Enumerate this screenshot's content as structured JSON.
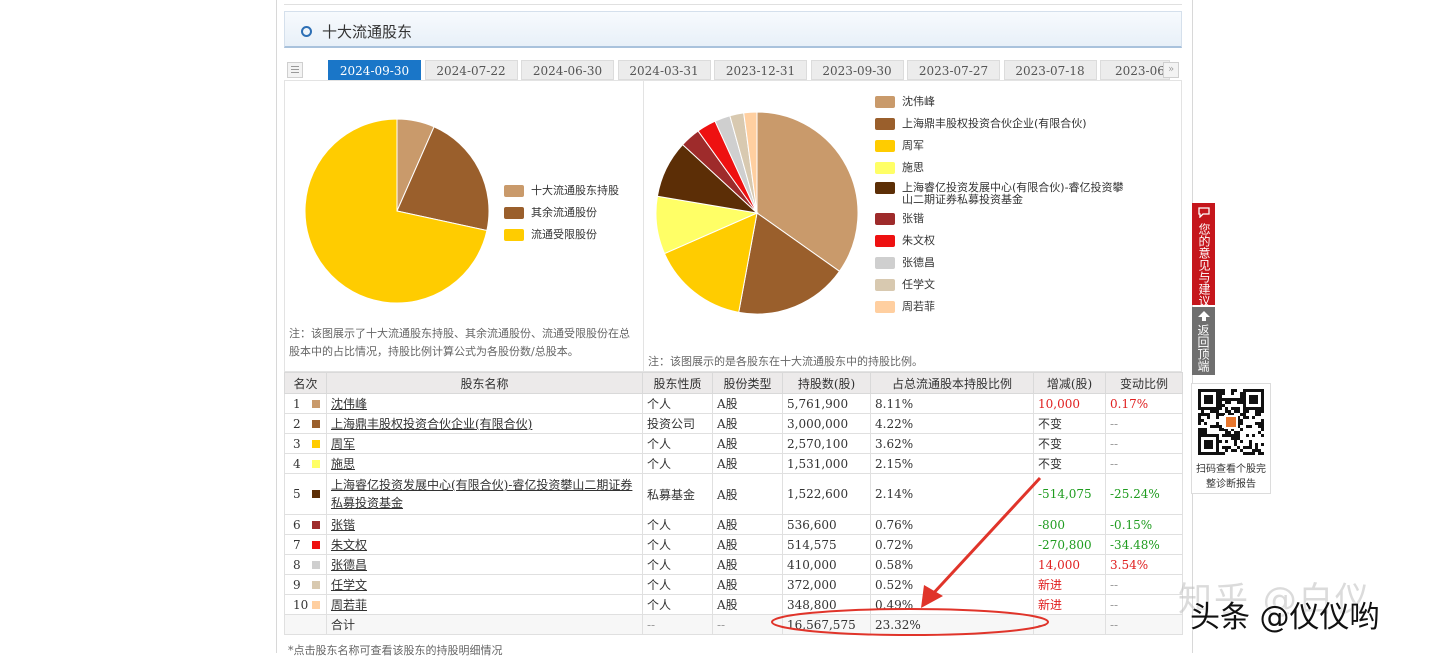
{
  "panel": {
    "title": "十大流通股东"
  },
  "tabs": [
    "2024-09-30",
    "2024-07-22",
    "2024-06-30",
    "2024-03-31",
    "2023-12-31",
    "2023-09-30",
    "2023-07-27",
    "2023-07-18",
    "2023-06"
  ],
  "active_tab": 0,
  "chart_data": [
    {
      "type": "pie",
      "legend": [
        "十大流通股东持股",
        "其余流通股份",
        "流通受限股份"
      ],
      "values": [
        6.6,
        21.8,
        71.6
      ],
      "colors": [
        "#c99a6b",
        "#9a5f2c",
        "#ffcc00"
      ]
    },
    {
      "type": "pie",
      "legend": [
        "沈伟峰",
        "上海鼎丰股权投资合伙企业(有限合伙)",
        "周军",
        "施思",
        "上海睿亿投资发展中心(有限合伙)-睿亿投资攀山二期证券私募投资基金",
        "张锴",
        "朱文权",
        "张德昌",
        "任学文",
        "周若菲"
      ],
      "values": [
        8.11,
        4.22,
        3.62,
        2.15,
        2.14,
        0.76,
        0.72,
        0.58,
        0.52,
        0.49
      ],
      "colors": [
        "#c99a6b",
        "#9a5f2c",
        "#ffcc00",
        "#ffff66",
        "#5c2e06",
        "#9e2b2b",
        "#ee1111",
        "#cfcfcf",
        "#d8c9b0",
        "#ffcfa0"
      ]
    }
  ],
  "notes": {
    "left": "注：该图展示了十大流通股东持股、其余流通股份、流通受限股份在总股本中的占比情况，持股比例计算公式为各股份数/总股本。",
    "right": "注：该图展示的是各股东在十大流通股东中的持股比例。"
  },
  "table": {
    "headers": [
      "名次",
      "股东名称",
      "股东性质",
      "股份类型",
      "持股数(股)",
      "占总流通股本持股比例",
      "增减(股)",
      "变动比例"
    ],
    "rows": [
      {
        "rank": "1",
        "color": "#c99a6b",
        "name": "沈伟峰",
        "nature": "个人",
        "type": "A股",
        "shares": "5,761,900",
        "ratio": "8.11%",
        "change": "10,000",
        "change_class": "red",
        "pct": "0.17%",
        "pct_class": "red"
      },
      {
        "rank": "2",
        "color": "#9a5f2c",
        "name": "上海鼎丰股权投资合伙企业(有限合伙)",
        "nature": "投资公司",
        "type": "A股",
        "shares": "3,000,000",
        "ratio": "4.22%",
        "change": "不变",
        "change_class": "",
        "pct": "--",
        "pct_class": "gray"
      },
      {
        "rank": "3",
        "color": "#ffcc00",
        "name": "周军",
        "nature": "个人",
        "type": "A股",
        "shares": "2,570,100",
        "ratio": "3.62%",
        "change": "不变",
        "change_class": "",
        "pct": "--",
        "pct_class": "gray"
      },
      {
        "rank": "4",
        "color": "#ffff66",
        "name": "施思",
        "nature": "个人",
        "type": "A股",
        "shares": "1,531,000",
        "ratio": "2.15%",
        "change": "不变",
        "change_class": "",
        "pct": "--",
        "pct_class": "gray"
      },
      {
        "rank": "5",
        "color": "#5c2e06",
        "name": "上海睿亿投资发展中心(有限合伙)-睿亿投资攀山二期证券私募投资基金",
        "nature": "私募基金",
        "type": "A股",
        "shares": "1,522,600",
        "ratio": "2.14%",
        "change": "-514,075",
        "change_class": "green",
        "pct": "-25.24%",
        "pct_class": "green"
      },
      {
        "rank": "6",
        "color": "#9e2b2b",
        "name": "张锴",
        "nature": "个人",
        "type": "A股",
        "shares": "536,600",
        "ratio": "0.76%",
        "change": "-800",
        "change_class": "green",
        "pct": "-0.15%",
        "pct_class": "green"
      },
      {
        "rank": "7",
        "color": "#ee1111",
        "name": "朱文权",
        "nature": "个人",
        "type": "A股",
        "shares": "514,575",
        "ratio": "0.72%",
        "change": "-270,800",
        "change_class": "green",
        "pct": "-34.48%",
        "pct_class": "green"
      },
      {
        "rank": "8",
        "color": "#cfcfcf",
        "name": "张德昌",
        "nature": "个人",
        "type": "A股",
        "shares": "410,000",
        "ratio": "0.58%",
        "change": "14,000",
        "change_class": "red",
        "pct": "3.54%",
        "pct_class": "red"
      },
      {
        "rank": "9",
        "color": "#d8c9b0",
        "name": "任学文",
        "nature": "个人",
        "type": "A股",
        "shares": "372,000",
        "ratio": "0.52%",
        "change": "新进",
        "change_class": "red",
        "pct": "--",
        "pct_class": "gray"
      },
      {
        "rank": "10",
        "color": "#ffcfa0",
        "name": "周若菲",
        "nature": "个人",
        "type": "A股",
        "shares": "348,800",
        "ratio": "0.49%",
        "change": "新进",
        "change_class": "red",
        "pct": "--",
        "pct_class": "gray"
      }
    ],
    "total": {
      "label": "合计",
      "nature": "--",
      "type": "--",
      "shares": "16,567,575",
      "ratio": "23.32%",
      "change": "--",
      "pct": "--"
    }
  },
  "footnote": "*点击股东名称可查看该股东的持股明细情况",
  "sidebar": {
    "feedback": "您的意见与建议",
    "back_top": "返回顶端",
    "qr_caption": "扫码查看个股完整诊断报告"
  },
  "watermark": {
    "zhihu": "知乎 @白仪",
    "toutiao": "头条 @仪仪哟"
  },
  "annotation_color": "#e0342a"
}
